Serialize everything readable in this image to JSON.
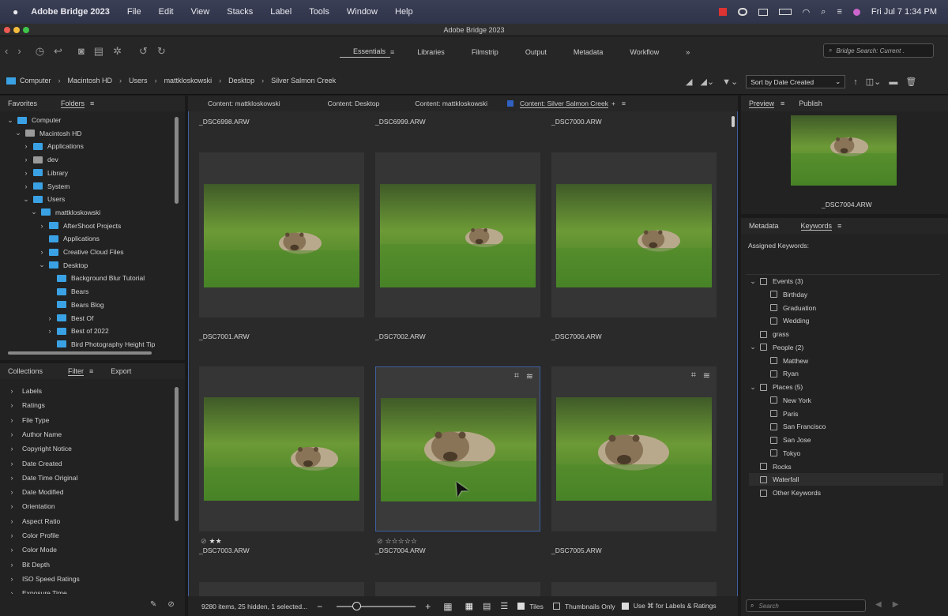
{
  "menubar": {
    "app": "Adobe Bridge 2023",
    "items": [
      "File",
      "Edit",
      "View",
      "Stacks",
      "Label",
      "Tools",
      "Window",
      "Help"
    ],
    "datetime": "Fri Jul 7  1:34 PM"
  },
  "window": {
    "title": "Adobe Bridge 2023"
  },
  "workspaces": {
    "items": [
      "Essentials",
      "Libraries",
      "Filmstrip",
      "Output",
      "Metadata",
      "Workflow"
    ],
    "active": "Essentials",
    "more": "»"
  },
  "search": {
    "placeholder": "Bridge Search: Current ."
  },
  "breadcrumb": [
    "Computer",
    "Macintosh HD",
    "Users",
    "mattkloskowski",
    "Desktop",
    "Silver Salmon Creek"
  ],
  "sort": {
    "label": "Sort by Date Created"
  },
  "left_tabs": {
    "favorites": "Favorites",
    "folders": "Folders"
  },
  "folders": [
    {
      "label": "Computer",
      "level": 0,
      "chev": "⌄",
      "icon": "blue"
    },
    {
      "label": "Macintosh HD",
      "level": 1,
      "chev": "⌄",
      "icon": "grey"
    },
    {
      "label": "Applications",
      "level": 2,
      "chev": "›",
      "icon": "blue"
    },
    {
      "label": "dev",
      "level": 2,
      "chev": "›",
      "icon": "grey"
    },
    {
      "label": "Library",
      "level": 2,
      "chev": "›",
      "icon": "blue"
    },
    {
      "label": "System",
      "level": 2,
      "chev": "›",
      "icon": "blue"
    },
    {
      "label": "Users",
      "level": 2,
      "chev": "⌄",
      "icon": "blue"
    },
    {
      "label": "mattkloskowski",
      "level": 3,
      "chev": "⌄",
      "icon": "blue"
    },
    {
      "label": "AfterShoot Projects",
      "level": 4,
      "chev": "›",
      "icon": "blue"
    },
    {
      "label": "Applications",
      "level": 4,
      "chev": "",
      "icon": "blue"
    },
    {
      "label": "Creative Cloud Files",
      "level": 4,
      "chev": "›",
      "icon": "blue"
    },
    {
      "label": "Desktop",
      "level": 4,
      "chev": "⌄",
      "icon": "blue"
    },
    {
      "label": "Background Blur Tutorial",
      "level": 5,
      "chev": "",
      "icon": "blue"
    },
    {
      "label": "Bears",
      "level": 5,
      "chev": "",
      "icon": "blue"
    },
    {
      "label": "Bears Blog",
      "level": 5,
      "chev": "",
      "icon": "blue"
    },
    {
      "label": "Best Of",
      "level": 5,
      "chev": "›",
      "icon": "blue"
    },
    {
      "label": "Best of 2022",
      "level": 5,
      "chev": "›",
      "icon": "blue"
    },
    {
      "label": "Bird Photography Height Tip",
      "level": 5,
      "chev": "",
      "icon": "blue"
    }
  ],
  "bottom_tabs": {
    "collections": "Collections",
    "filter": "Filter",
    "export": "Export"
  },
  "filters": [
    "Labels",
    "Ratings",
    "File Type",
    "Author Name",
    "Copyright Notice",
    "Date Created",
    "Date Time Original",
    "Date Modified",
    "Orientation",
    "Aspect Ratio",
    "Color Profile",
    "Color Mode",
    "Bit Depth",
    "ISO Speed Ratings",
    "Exposure Time"
  ],
  "content_tabs": [
    "Content: mattkloskowski",
    "Content: Desktop",
    "Content: mattkloskowski",
    "Content: Silver Salmon Creek"
  ],
  "top_names": [
    "_DSC6998.ARW",
    "_DSC6999.ARW",
    "_DSC7000.ARW"
  ],
  "row1": [
    {
      "name": "_DSC7001.ARW"
    },
    {
      "name": "_DSC7002.ARW"
    },
    {
      "name": "_DSC7006.ARW"
    }
  ],
  "row2": [
    {
      "name": "_DSC7003.ARW",
      "stars": "★★",
      "rating": 2
    },
    {
      "name": "_DSC7004.ARW",
      "stars": "☆☆☆☆☆",
      "rating": 0,
      "selected": true
    },
    {
      "name": "_DSC7005.ARW"
    }
  ],
  "preview": {
    "tab": "Preview",
    "publish": "Publish",
    "filename": "_DSC7004.ARW"
  },
  "meta_tabs": {
    "metadata": "Metadata",
    "keywords": "Keywords"
  },
  "assigned": "Assigned Keywords:",
  "keywords": [
    {
      "label": "Events (3)",
      "level": 0,
      "chev": "⌄"
    },
    {
      "label": "Birthday",
      "level": 1
    },
    {
      "label": "Graduation",
      "level": 1
    },
    {
      "label": "Wedding",
      "level": 1
    },
    {
      "label": "grass",
      "level": 0,
      "chev": ""
    },
    {
      "label": "People (2)",
      "level": 0,
      "chev": "⌄"
    },
    {
      "label": "Matthew",
      "level": 1
    },
    {
      "label": "Ryan",
      "level": 1
    },
    {
      "label": "Places (5)",
      "level": 0,
      "chev": "⌄"
    },
    {
      "label": "New York",
      "level": 1
    },
    {
      "label": "Paris",
      "level": 1
    },
    {
      "label": "San Francisco",
      "level": 1
    },
    {
      "label": "San Jose",
      "level": 1
    },
    {
      "label": "Tokyo",
      "level": 1
    },
    {
      "label": "Rocks",
      "level": 0,
      "chev": ""
    },
    {
      "label": "Waterfall",
      "level": 0,
      "chev": ""
    },
    {
      "label": "Other Keywords",
      "level": 0,
      "chev": ""
    }
  ],
  "kw_search": {
    "placeholder": "Search"
  },
  "status": {
    "count": "9280 items, 25 hidden, 1 selected...",
    "tiles": "Tiles",
    "thumbs_only": "Thumbnails Only",
    "use_cmd": "Use ⌘ for Labels & Ratings"
  },
  "colors": {
    "accent": "#3e5fa0",
    "folder": "#3aa2e4",
    "grass": "#5f8f2f"
  }
}
